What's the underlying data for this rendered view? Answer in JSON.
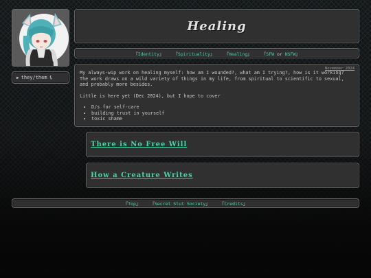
{
  "site": {
    "title": "Healing"
  },
  "profile": {
    "pronouns": "they/them",
    "pronoun_symbol": "⚸"
  },
  "nav": {
    "items": [
      {
        "label": "Identity"
      },
      {
        "label": "Spirituality"
      },
      {
        "label": "Healing"
      },
      {
        "label_a": "SFW",
        "separator": "or",
        "label_b": "NSFW"
      }
    ],
    "open_bracket": "『",
    "close_bracket": "』"
  },
  "content": {
    "date": "November 2024",
    "intro": "My always-wip work on healing myself: how am I wounded?, what am I trying?, how is it working? The work draws on a wild variety of things in my life, from spiritual to scientific to sexual, and probably more besides.",
    "status": "Little is here yet (Dec 2024), but I hope to cover",
    "topics": [
      "D/s for self-care",
      "building trust in yourself",
      "toxic shame"
    ]
  },
  "cards": [
    {
      "title": "There is No Free Will"
    },
    {
      "title": "How a Creature Writes"
    }
  ],
  "footer": {
    "items": [
      {
        "label": "Top"
      },
      {
        "label": "Secret Slut Society"
      },
      {
        "label": "Credits"
      }
    ]
  },
  "colors": {
    "accent": "#46d6a9",
    "panel": "#303030",
    "border": "#6a6a6a",
    "text": "#c9c9c9"
  }
}
